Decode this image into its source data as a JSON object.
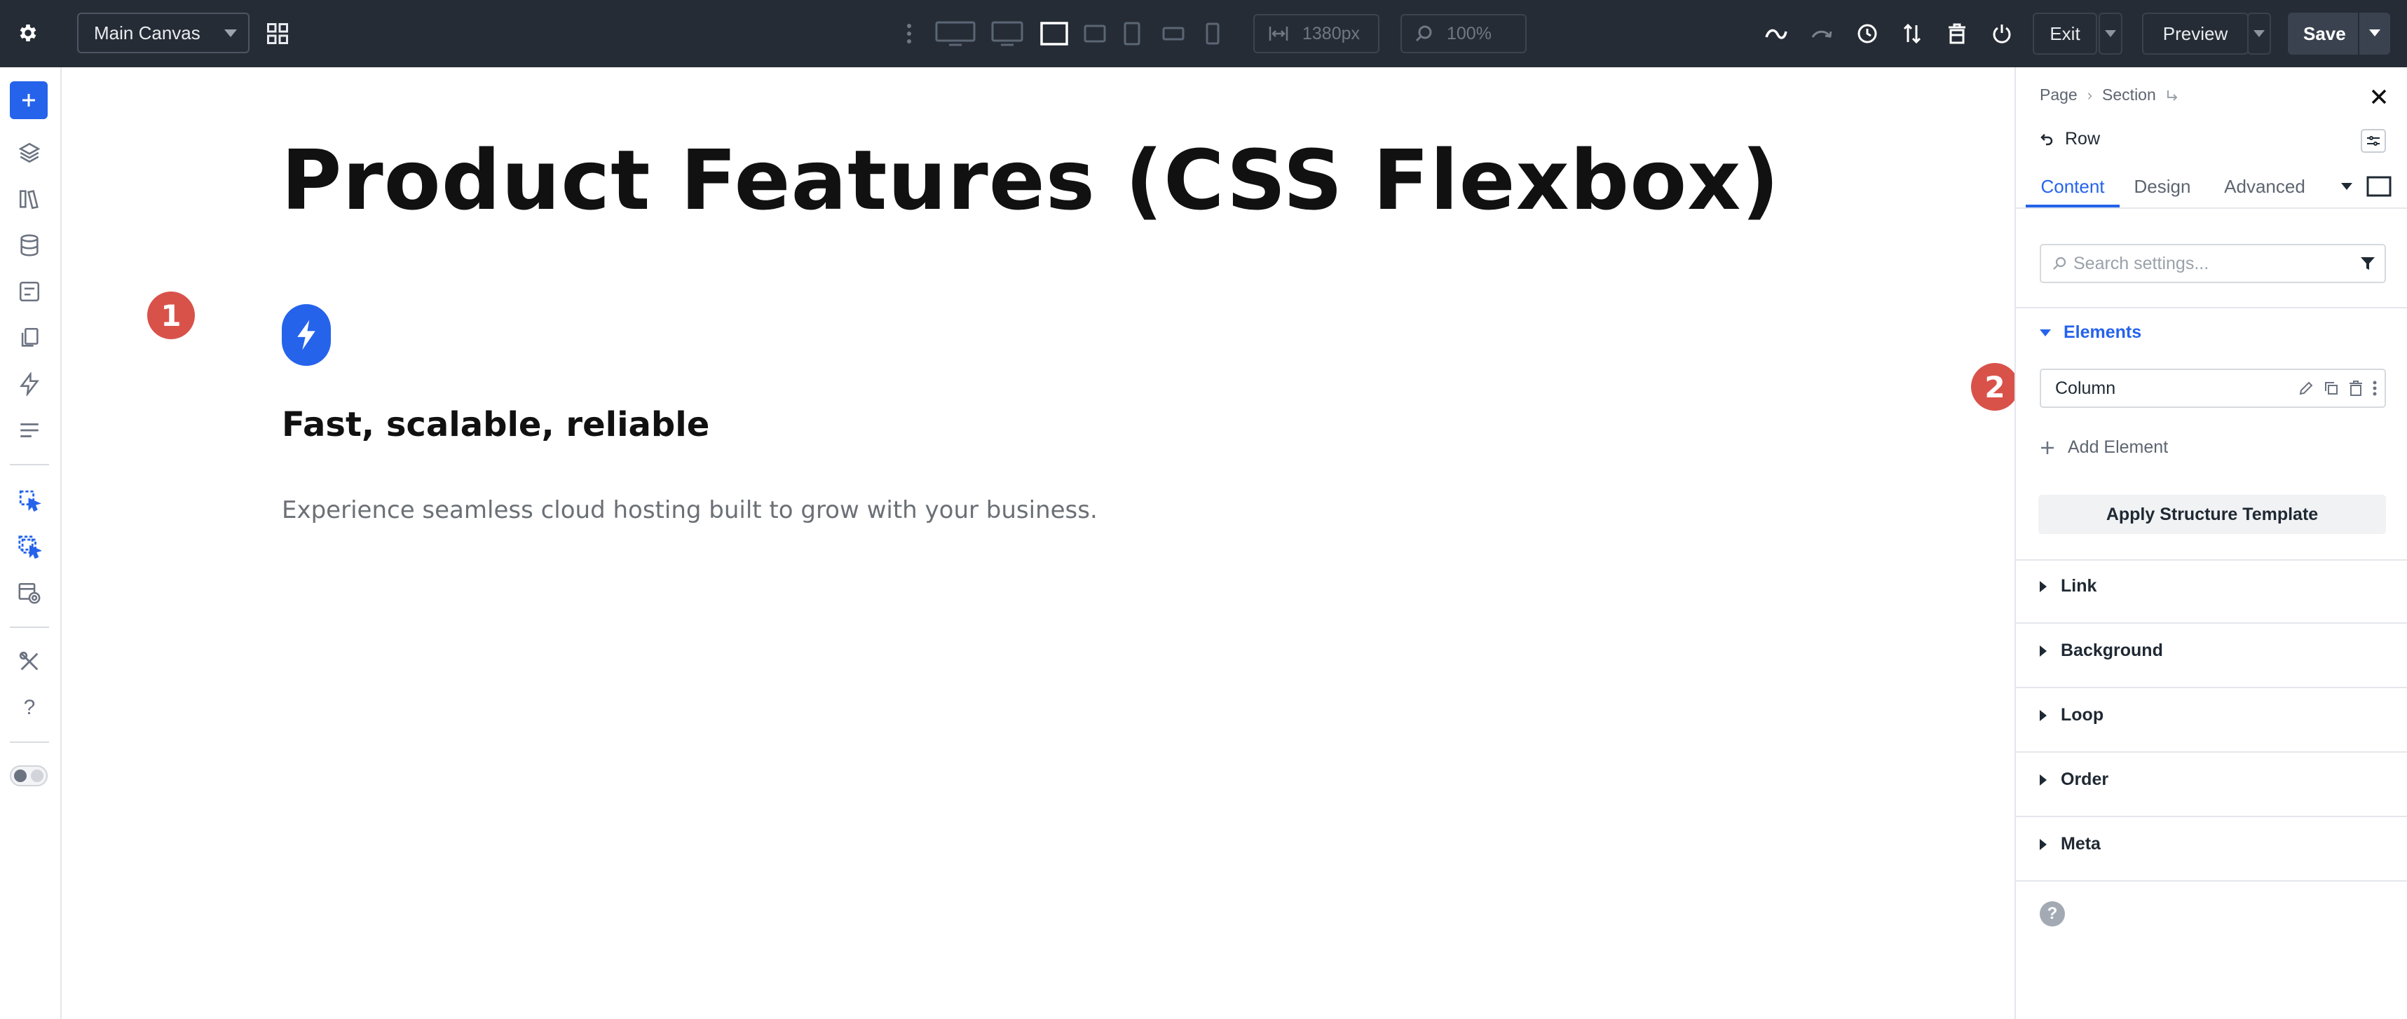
{
  "topbar": {
    "canvas_select": "Main Canvas",
    "width_value": "1380px",
    "zoom_value": "100%",
    "exit_label": "Exit",
    "preview_label": "Preview",
    "save_label": "Save",
    "icons": [
      "gear-icon",
      "grid-icon",
      "more-vertical-icon",
      "desktop-wide-icon",
      "desktop-icon",
      "laptop-icon",
      "tablet-landscape-icon",
      "tablet-icon",
      "phone-landscape-icon",
      "phone-icon",
      "width-icon",
      "zoom-icon",
      "undo-icon",
      "redo-icon",
      "history-icon",
      "sort-icon",
      "delete-icon",
      "power-icon"
    ]
  },
  "sidebar": {
    "icons": [
      "add-icon",
      "layers-icon",
      "library-icon",
      "database-icon",
      "form-icon",
      "pages-icon",
      "bolt-icon",
      "layout-icon",
      "cursor-select-icon",
      "cursor-multi-select-icon",
      "page-settings-icon",
      "tools-icon",
      "help-icon",
      "theme-toggle"
    ]
  },
  "canvas": {
    "heading": "Product Features (CSS Flexbox)",
    "subheading": "Fast, scalable, reliable",
    "body": "Experience seamless cloud hosting built to grow with your business.",
    "marker1": "1",
    "marker2": "2"
  },
  "panel": {
    "breadcrumb": [
      "Page",
      "Section"
    ],
    "row_title": "Row",
    "tabs": [
      "Content",
      "Design",
      "Advanced"
    ],
    "active_tab": "Content",
    "search_placeholder": "Search settings...",
    "elements_title": "Elements",
    "column_label": "Column",
    "add_element_label": "Add Element",
    "apply_template_label": "Apply Structure Template",
    "sections": [
      "Link",
      "Background",
      "Loop",
      "Order",
      "Meta"
    ],
    "help": "?"
  },
  "colors": {
    "accent": "#2563eb",
    "topbar": "#262c35",
    "marker": "#d9524a"
  }
}
